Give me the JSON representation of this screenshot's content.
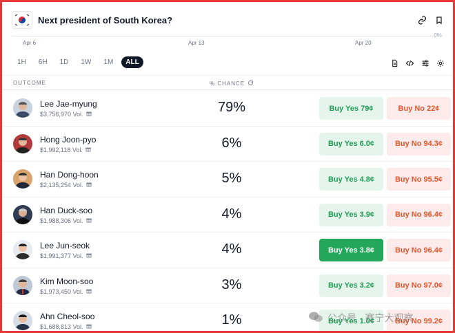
{
  "header": {
    "title": "Next president of South Korea?"
  },
  "chart": {
    "dates": [
      "Apr 6",
      "Apr 13",
      "Apr 20"
    ],
    "edge_label": "0%"
  },
  "ranges": [
    "1H",
    "6H",
    "1D",
    "1W",
    "1M",
    "ALL"
  ],
  "columns": {
    "outcome": "OUTCOME",
    "chance": "% CHANCE"
  },
  "rows": [
    {
      "name": "Lee Jae-myung",
      "vol": "$3,756,970 Vol.",
      "chance": "79%",
      "yes": "Buy Yes 79¢",
      "no": "Buy No 22¢"
    },
    {
      "name": "Hong Joon-pyo",
      "vol": "$1,992,118 Vol.",
      "chance": "6%",
      "yes": "Buy Yes 6.0¢",
      "no": "Buy No 94.3¢"
    },
    {
      "name": "Han Dong-hoon",
      "vol": "$2,135,254 Vol.",
      "chance": "5%",
      "yes": "Buy Yes 4.8¢",
      "no": "Buy No 95.5¢"
    },
    {
      "name": "Han Duck-soo",
      "vol": "$1,988,306 Vol.",
      "chance": "4%",
      "yes": "Buy Yes 3.9¢",
      "no": "Buy No 96.4¢"
    },
    {
      "name": "Lee Jun-seok",
      "vol": "$1,991,377 Vol.",
      "chance": "4%",
      "yes": "Buy Yes 3.8¢",
      "no": "Buy No 96.4¢"
    },
    {
      "name": "Kim Moon-soo",
      "vol": "$1,973,450 Vol.",
      "chance": "3%",
      "yes": "Buy Yes 3.2¢",
      "no": "Buy No 97.0¢"
    },
    {
      "name": "Ahn Cheol-soo",
      "vol": "$1,688,813 Vol.",
      "chance": "1%",
      "yes": "Buy Yes 1.0¢",
      "no": "Buy No 99.2¢"
    }
  ],
  "watermark": "公众号 · 赛宁大观察",
  "colors": {
    "yes_text": "#1f9d55",
    "yes_bg": "#e6f5ec",
    "yes_active": "#22a75b",
    "no_text": "#e2572b",
    "no_bg": "#fdeaea",
    "frame": "#e53935"
  }
}
